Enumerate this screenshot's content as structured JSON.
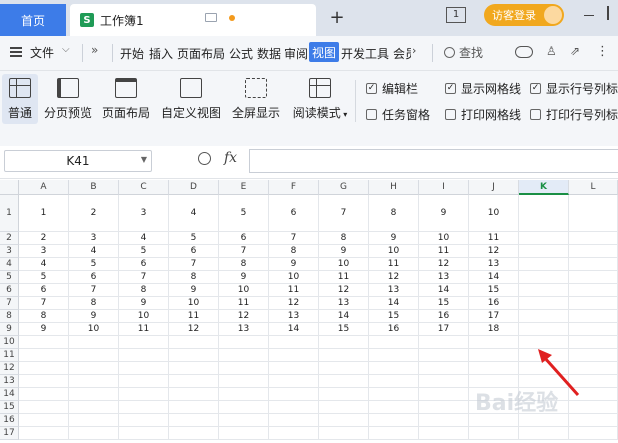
{
  "titlebar": {
    "home_tab": "首页",
    "doc_icon_letter": "S",
    "doc_title": "工作簿1",
    "new_tab": "+",
    "page_indicator": "1",
    "visitor_login": "访客登录"
  },
  "menubar": {
    "file": "文件",
    "more": "»",
    "items": [
      "开始",
      "插入",
      "页面布局",
      "公式",
      "数据",
      "审阅",
      "视图",
      "开发工具",
      "会员"
    ],
    "active_item": "视图",
    "search": "查找",
    "more_dots": "⋮"
  },
  "ribbon": {
    "buttons": [
      {
        "label": "普通",
        "icon": "grid-icon",
        "active": true
      },
      {
        "label": "分页预览",
        "icon": "page-break-icon"
      },
      {
        "label": "页面布局",
        "icon": "page-layout-icon"
      },
      {
        "label": "自定义视图",
        "icon": "custom-view-icon"
      },
      {
        "label": "全屏显示",
        "icon": "fullscreen-icon"
      },
      {
        "label": "阅读模式",
        "icon": "reading-mode-icon"
      }
    ],
    "checks": [
      {
        "label": "编辑栏",
        "checked": true
      },
      {
        "label": "显示网格线",
        "checked": true
      },
      {
        "label": "显示行号列标",
        "checked": true
      },
      {
        "label": "任务窗格",
        "checked": false
      },
      {
        "label": "打印网格线",
        "checked": false
      },
      {
        "label": "打印行号列标",
        "checked": false
      }
    ]
  },
  "formulabar": {
    "name_box": "K41",
    "fx": "fx"
  },
  "sheet": {
    "columns": [
      "A",
      "B",
      "C",
      "D",
      "E",
      "F",
      "G",
      "H",
      "I",
      "J",
      "K",
      "L"
    ],
    "selected_column": "K",
    "rows": [
      [
        "1",
        "2",
        "3",
        "4",
        "5",
        "6",
        "7",
        "8",
        "9",
        "10"
      ],
      [
        "2",
        "3",
        "4",
        "5",
        "6",
        "7",
        "8",
        "9",
        "10",
        "11"
      ],
      [
        "3",
        "4",
        "5",
        "6",
        "7",
        "8",
        "9",
        "10",
        "11",
        "12"
      ],
      [
        "4",
        "5",
        "6",
        "7",
        "8",
        "9",
        "10",
        "11",
        "12",
        "13"
      ],
      [
        "5",
        "6",
        "7",
        "8",
        "9",
        "10",
        "11",
        "12",
        "13",
        "14"
      ],
      [
        "6",
        "7",
        "8",
        "9",
        "10",
        "11",
        "12",
        "13",
        "14",
        "15"
      ],
      [
        "7",
        "8",
        "9",
        "10",
        "11",
        "12",
        "13",
        "14",
        "15",
        "16"
      ],
      [
        "8",
        "9",
        "10",
        "11",
        "12",
        "13",
        "14",
        "15",
        "16",
        "17"
      ],
      [
        "9",
        "10",
        "11",
        "12",
        "13",
        "14",
        "15",
        "16",
        "17",
        "18"
      ]
    ],
    "row_numbers": [
      "1",
      "2",
      "3",
      "4",
      "5",
      "6",
      "7",
      "8",
      "9",
      "10",
      "11",
      "12",
      "13",
      "14",
      "15",
      "16",
      "17"
    ]
  },
  "watermark": "Bai经验"
}
